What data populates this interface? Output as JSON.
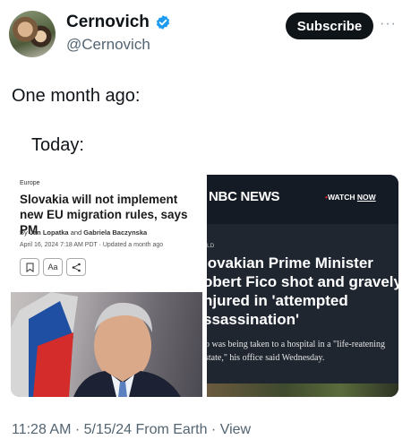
{
  "author": {
    "name": "Cernovich",
    "handle": "@Cernovich",
    "verified_icon": "verified-badge-icon",
    "subscribe_label": "Subscribe",
    "more_label": "···"
  },
  "tweet": {
    "line1": "One month ago:",
    "line2": "Today:",
    "footer": "11:28 AM · 5/15/24 From Earth · View"
  },
  "left_card": {
    "category": "Europe",
    "headline": "Slovakia will not implement new EU migration rules, says PM",
    "byline_prefix": "By ",
    "author1": "Jan Lopatka",
    "byline_and": " and ",
    "author2": "Gabriela Baczynska",
    "dateline": "April 16, 2024 7:18 AM PDT · Updated a month ago",
    "actions": {
      "bookmark_icon": "bookmark-icon",
      "text_size_label": "Aa",
      "share_icon": "share-icon"
    }
  },
  "right_card": {
    "logo": "NBC NEWS",
    "watch_dot": "•",
    "watch_label": "WATCH ",
    "watch_now": "NOW",
    "tag": "LD",
    "headline": "lovakian Prime Minister obert Fico shot and gravely njured in 'attempted ssassination'",
    "subtext": "o was being taken to a hospital in a \"life-reatening state,\" his office said Wednesday."
  },
  "colors": {
    "text": "#0f1419",
    "muted": "#536471",
    "nbc_bg": "#1f2630",
    "nbc_red": "#e0202a",
    "verified_blue": "#1d9bf0"
  }
}
